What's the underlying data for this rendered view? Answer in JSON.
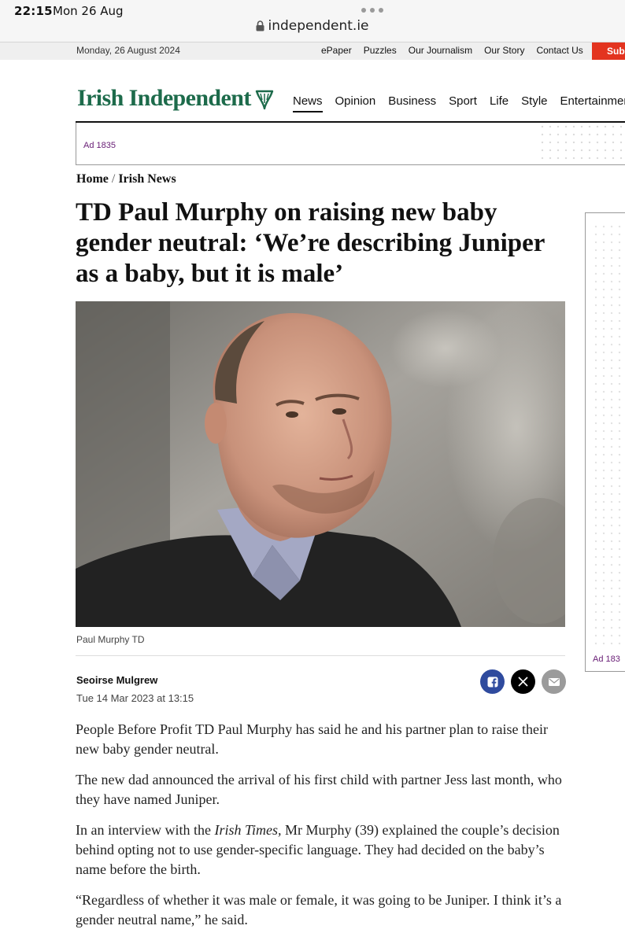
{
  "status_bar": {
    "time": "22:15",
    "date": "Mon 26 Aug"
  },
  "browser": {
    "url": "independent.ie"
  },
  "utility_bar": {
    "date": "Monday, 26 August 2024",
    "links": [
      "ePaper",
      "Puzzles",
      "Our Journalism",
      "Our Story",
      "Contact Us"
    ],
    "subscribe": "Subs"
  },
  "masthead": {
    "logo": "Irish Independent",
    "nav": [
      "News",
      "Opinion",
      "Business",
      "Sport",
      "Life",
      "Style",
      "Entertainment"
    ],
    "active_nav": "News"
  },
  "ads": {
    "banner_label": "Ad 1835",
    "side_label": "Ad 183"
  },
  "breadcrumb": {
    "home": "Home",
    "separator": "/",
    "section": "Irish News"
  },
  "article": {
    "headline": "TD Paul Murphy on raising new baby gender neutral: ‘We’re describing Juniper as a baby, but it is male’",
    "image_caption": "Paul Murphy TD",
    "author": "Seoirse Mulgrew",
    "published": "Tue 14 Mar 2023 at 13:15",
    "paragraphs": [
      {
        "text": "People Before Profit TD Paul Murphy has said he and his partner plan to raise their new baby gender neutral."
      },
      {
        "text": "The new dad announced the arrival of his first child with partner Jess last month, who they have named Juniper."
      },
      {
        "before": "In an interview with the ",
        "italic": "Irish Times,",
        "after": " Mr Murphy (39) explained the couple’s decision behind opting not to use gender-specific language. They had decided on the baby’s name before the birth."
      },
      {
        "text": "“Regardless of whether it was male or female, it was going to be Juniper. I think it’s a gender neutral name,” he said."
      }
    ]
  },
  "share_icons": [
    "facebook-icon",
    "x-icon",
    "email-icon"
  ],
  "colors": {
    "brand_green": "#1d6b4b",
    "subscribe_red": "#e3341f",
    "facebook_blue": "#2f4b9e",
    "ad_label_purple": "#6a2077"
  }
}
